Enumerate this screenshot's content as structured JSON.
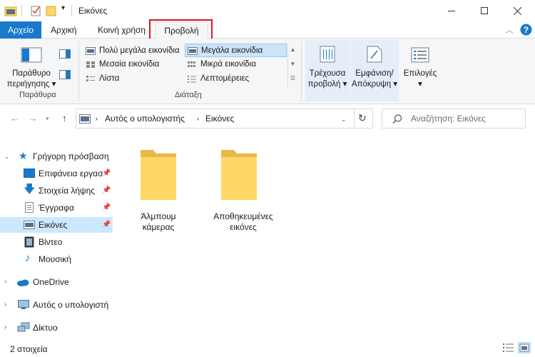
{
  "window": {
    "title": "Εικόνες",
    "minimize": "—",
    "maximize": "☐",
    "close": "✕"
  },
  "tabs": {
    "file": "Αρχείο",
    "home": "Αρχική",
    "share": "Κοινή χρήση",
    "view": "Προβολή"
  },
  "ribbon": {
    "nav_pane_label": "Παράθυρο περιήγησης",
    "nav_pane_line1": "Παράθυρο",
    "nav_pane_line2": "περιήγησης",
    "panes_group": "Παράθυρα",
    "layout_group": "Διάταξη",
    "layout": {
      "extra_large": "Πολύ μεγάλα εικονίδια",
      "large": "Μεγάλα εικονίδια",
      "medium": "Μεσαία εικονίδια",
      "small": "Μικρά εικονίδια",
      "list": "Λίστα",
      "details": "Λεπτομέρειες",
      "selected": "large"
    },
    "current_view_line1": "Τρέχουσα",
    "current_view_line2": "προβολή",
    "show_hide_line1": "Εμφάνιση/",
    "show_hide_line2": "Απόκρυψη",
    "options": "Επιλογές"
  },
  "address": {
    "segment1": "Αυτός ο υπολογιστής",
    "segment2": "Εικόνες",
    "search_placeholder": "Αναζήτηση: Εικόνες"
  },
  "sidebar": {
    "quick_access": "Γρήγορη πρόσβαση",
    "items": [
      {
        "label": "Επιφάνεια εργασ",
        "pinned": true
      },
      {
        "label": "Στοιχεία λήψης",
        "pinned": true
      },
      {
        "label": "Έγγραφα",
        "pinned": true
      },
      {
        "label": "Εικόνες",
        "pinned": true,
        "selected": true
      },
      {
        "label": "Βίντεο",
        "pinned": false
      },
      {
        "label": "Μουσική",
        "pinned": false
      }
    ],
    "onedrive": "OneDrive",
    "this_pc": "Αυτός ο υπολογιστή",
    "network": "Δίκτυο"
  },
  "content": {
    "folders": [
      {
        "line1": "Άλμπουμ",
        "line2": "κάμερας"
      },
      {
        "line1": "Αποθηκευμένες",
        "line2": "εικόνες"
      }
    ]
  },
  "status": {
    "count": "2 στοιχεία"
  },
  "colors": {
    "accent": "#1979ca",
    "selection": "#cce8ff",
    "highlight_box": "#e0141e",
    "folder": "#ffd766"
  }
}
